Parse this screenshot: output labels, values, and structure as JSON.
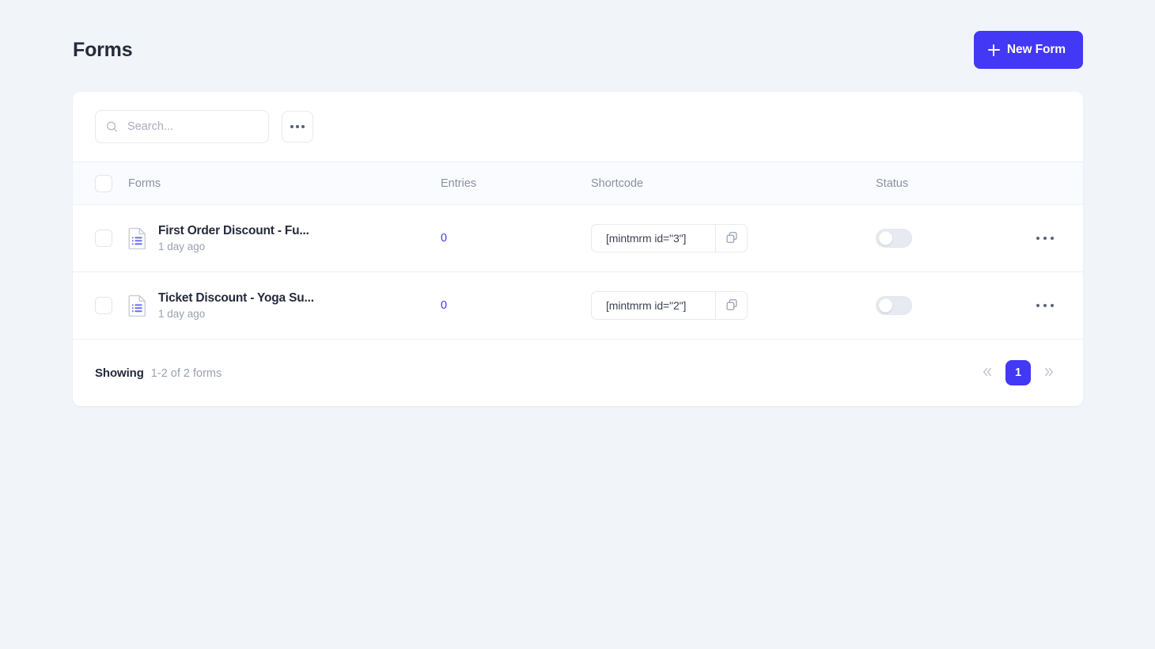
{
  "header": {
    "title": "Forms",
    "new_form_label": "New Form",
    "accent_color": "#4338f5"
  },
  "toolbar": {
    "search_placeholder": "Search...",
    "search_value": "",
    "search_icon": "search-icon",
    "more_icon": "ellipsis-icon"
  },
  "table": {
    "columns": [
      {
        "key": "forms",
        "label": "Forms"
      },
      {
        "key": "entries",
        "label": "Entries"
      },
      {
        "key": "shortcode",
        "label": "Shortcode"
      },
      {
        "key": "status",
        "label": "Status"
      }
    ],
    "rows": [
      {
        "name": "First Order Discount - Fu...",
        "date": "1 day ago",
        "entries": "0",
        "shortcode": "[mintmrm id=\"3\"]",
        "status_enabled": false,
        "icon": "document-list-icon"
      },
      {
        "name": "Ticket Discount - Yoga Su...",
        "date": "1 day ago",
        "entries": "0",
        "shortcode": "[mintmrm id=\"2\"]",
        "status_enabled": false,
        "icon": "document-list-icon"
      }
    ]
  },
  "footer": {
    "showing_label": "Showing",
    "showing_range": "1-2 of 2 forms",
    "pagination": {
      "first_icon": "double-chevron-left-icon",
      "last_icon": "double-chevron-right-icon",
      "current_page": "1"
    }
  }
}
